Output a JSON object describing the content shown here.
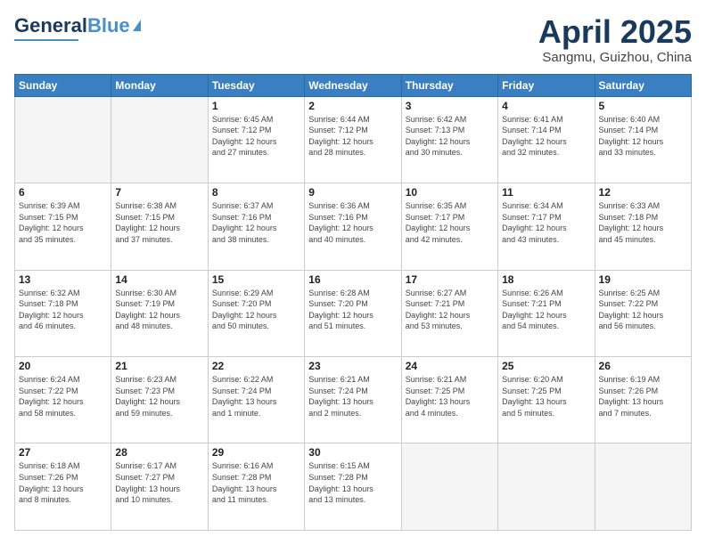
{
  "header": {
    "logo_general": "General",
    "logo_blue": "Blue",
    "month_title": "April 2025",
    "location": "Sangmu, Guizhou, China"
  },
  "weekdays": [
    "Sunday",
    "Monday",
    "Tuesday",
    "Wednesday",
    "Thursday",
    "Friday",
    "Saturday"
  ],
  "weeks": [
    [
      {
        "day": "",
        "info": ""
      },
      {
        "day": "",
        "info": ""
      },
      {
        "day": "1",
        "info": "Sunrise: 6:45 AM\nSunset: 7:12 PM\nDaylight: 12 hours\nand 27 minutes."
      },
      {
        "day": "2",
        "info": "Sunrise: 6:44 AM\nSunset: 7:12 PM\nDaylight: 12 hours\nand 28 minutes."
      },
      {
        "day": "3",
        "info": "Sunrise: 6:42 AM\nSunset: 7:13 PM\nDaylight: 12 hours\nand 30 minutes."
      },
      {
        "day": "4",
        "info": "Sunrise: 6:41 AM\nSunset: 7:14 PM\nDaylight: 12 hours\nand 32 minutes."
      },
      {
        "day": "5",
        "info": "Sunrise: 6:40 AM\nSunset: 7:14 PM\nDaylight: 12 hours\nand 33 minutes."
      }
    ],
    [
      {
        "day": "6",
        "info": "Sunrise: 6:39 AM\nSunset: 7:15 PM\nDaylight: 12 hours\nand 35 minutes."
      },
      {
        "day": "7",
        "info": "Sunrise: 6:38 AM\nSunset: 7:15 PM\nDaylight: 12 hours\nand 37 minutes."
      },
      {
        "day": "8",
        "info": "Sunrise: 6:37 AM\nSunset: 7:16 PM\nDaylight: 12 hours\nand 38 minutes."
      },
      {
        "day": "9",
        "info": "Sunrise: 6:36 AM\nSunset: 7:16 PM\nDaylight: 12 hours\nand 40 minutes."
      },
      {
        "day": "10",
        "info": "Sunrise: 6:35 AM\nSunset: 7:17 PM\nDaylight: 12 hours\nand 42 minutes."
      },
      {
        "day": "11",
        "info": "Sunrise: 6:34 AM\nSunset: 7:17 PM\nDaylight: 12 hours\nand 43 minutes."
      },
      {
        "day": "12",
        "info": "Sunrise: 6:33 AM\nSunset: 7:18 PM\nDaylight: 12 hours\nand 45 minutes."
      }
    ],
    [
      {
        "day": "13",
        "info": "Sunrise: 6:32 AM\nSunset: 7:18 PM\nDaylight: 12 hours\nand 46 minutes."
      },
      {
        "day": "14",
        "info": "Sunrise: 6:30 AM\nSunset: 7:19 PM\nDaylight: 12 hours\nand 48 minutes."
      },
      {
        "day": "15",
        "info": "Sunrise: 6:29 AM\nSunset: 7:20 PM\nDaylight: 12 hours\nand 50 minutes."
      },
      {
        "day": "16",
        "info": "Sunrise: 6:28 AM\nSunset: 7:20 PM\nDaylight: 12 hours\nand 51 minutes."
      },
      {
        "day": "17",
        "info": "Sunrise: 6:27 AM\nSunset: 7:21 PM\nDaylight: 12 hours\nand 53 minutes."
      },
      {
        "day": "18",
        "info": "Sunrise: 6:26 AM\nSunset: 7:21 PM\nDaylight: 12 hours\nand 54 minutes."
      },
      {
        "day": "19",
        "info": "Sunrise: 6:25 AM\nSunset: 7:22 PM\nDaylight: 12 hours\nand 56 minutes."
      }
    ],
    [
      {
        "day": "20",
        "info": "Sunrise: 6:24 AM\nSunset: 7:22 PM\nDaylight: 12 hours\nand 58 minutes."
      },
      {
        "day": "21",
        "info": "Sunrise: 6:23 AM\nSunset: 7:23 PM\nDaylight: 12 hours\nand 59 minutes."
      },
      {
        "day": "22",
        "info": "Sunrise: 6:22 AM\nSunset: 7:24 PM\nDaylight: 13 hours\nand 1 minute."
      },
      {
        "day": "23",
        "info": "Sunrise: 6:21 AM\nSunset: 7:24 PM\nDaylight: 13 hours\nand 2 minutes."
      },
      {
        "day": "24",
        "info": "Sunrise: 6:21 AM\nSunset: 7:25 PM\nDaylight: 13 hours\nand 4 minutes."
      },
      {
        "day": "25",
        "info": "Sunrise: 6:20 AM\nSunset: 7:25 PM\nDaylight: 13 hours\nand 5 minutes."
      },
      {
        "day": "26",
        "info": "Sunrise: 6:19 AM\nSunset: 7:26 PM\nDaylight: 13 hours\nand 7 minutes."
      }
    ],
    [
      {
        "day": "27",
        "info": "Sunrise: 6:18 AM\nSunset: 7:26 PM\nDaylight: 13 hours\nand 8 minutes."
      },
      {
        "day": "28",
        "info": "Sunrise: 6:17 AM\nSunset: 7:27 PM\nDaylight: 13 hours\nand 10 minutes."
      },
      {
        "day": "29",
        "info": "Sunrise: 6:16 AM\nSunset: 7:28 PM\nDaylight: 13 hours\nand 11 minutes."
      },
      {
        "day": "30",
        "info": "Sunrise: 6:15 AM\nSunset: 7:28 PM\nDaylight: 13 hours\nand 13 minutes."
      },
      {
        "day": "",
        "info": ""
      },
      {
        "day": "",
        "info": ""
      },
      {
        "day": "",
        "info": ""
      }
    ]
  ]
}
